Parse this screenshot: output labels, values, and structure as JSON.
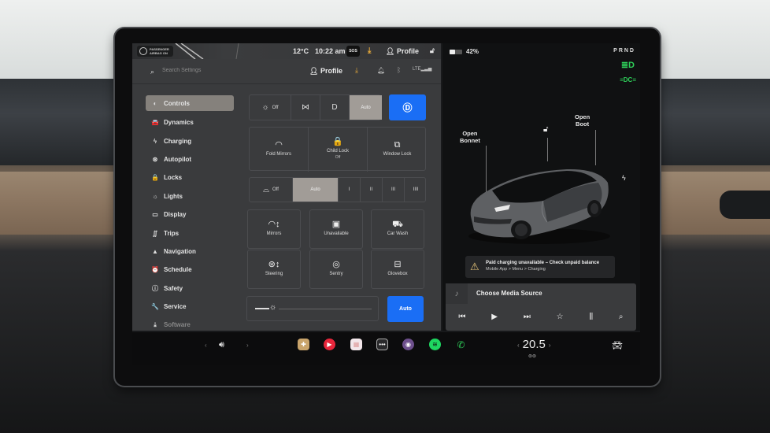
{
  "status_bar": {
    "airbag_label": "PASSENGER AIRBAG ON",
    "temperature": "12°C",
    "time": "10:22 am",
    "sos_label": "SOS",
    "profile": "Profile"
  },
  "settings_header": {
    "search_placeholder": "Search Settings",
    "profile": "Profile"
  },
  "sidebar": {
    "items": [
      {
        "label": "Controls",
        "icon": "toggle-icon",
        "glyph": "◐",
        "active": true
      },
      {
        "label": "Dynamics",
        "icon": "car-icon",
        "glyph": "🚘"
      },
      {
        "label": "Charging",
        "icon": "bolt-icon",
        "glyph": "ϟ"
      },
      {
        "label": "Autopilot",
        "icon": "steering-wheel-icon",
        "glyph": "⊛"
      },
      {
        "label": "Locks",
        "icon": "lock-icon",
        "glyph": "🔒"
      },
      {
        "label": "Lights",
        "icon": "light-icon",
        "glyph": "☼"
      },
      {
        "label": "Display",
        "icon": "display-icon",
        "glyph": "▭"
      },
      {
        "label": "Trips",
        "icon": "trips-icon",
        "glyph": "∬"
      },
      {
        "label": "Navigation",
        "icon": "navigation-icon",
        "glyph": "▲"
      },
      {
        "label": "Schedule",
        "icon": "alarm-icon",
        "glyph": "⏰"
      },
      {
        "label": "Safety",
        "icon": "safety-icon",
        "glyph": "ⓘ"
      },
      {
        "label": "Service",
        "icon": "wrench-icon",
        "glyph": "🔧"
      },
      {
        "label": "Software",
        "icon": "download-icon",
        "glyph": "⤓"
      }
    ]
  },
  "controls": {
    "lights": {
      "options": [
        {
          "label": "Off",
          "icon": "sun-icon",
          "glyph": "☼"
        },
        {
          "label": "",
          "icon": "parking-lights-icon",
          "glyph": "⋈"
        },
        {
          "label": "",
          "icon": "low-beam-icon",
          "glyph": "D"
        },
        {
          "label": "Auto",
          "icon": "",
          "glyph": "",
          "selected": true
        }
      ],
      "auto_high_beam_glyph": "Ⓓ"
    },
    "tiles_row1": [
      {
        "label": "Fold Mirrors",
        "sub": "",
        "icon": "mirror-icon",
        "glyph": "◠"
      },
      {
        "label": "Child Lock",
        "sub": "Off",
        "icon": "child-lock-icon",
        "glyph": "🔒"
      },
      {
        "label": "Window Lock",
        "sub": "",
        "icon": "window-lock-icon",
        "glyph": "⧉"
      }
    ],
    "wipers": {
      "options": [
        {
          "label": "Off",
          "icon": "wiper-icon",
          "glyph": "⌓"
        },
        {
          "label": "Auto",
          "selected": true
        },
        {
          "label": "I"
        },
        {
          "label": "II"
        },
        {
          "label": "III"
        },
        {
          "label": "IIII"
        }
      ]
    },
    "tiles_grid": [
      {
        "label": "Mirrors",
        "icon": "mirror-adjust-icon",
        "glyph": "◠↕"
      },
      {
        "label": "Unavailable",
        "icon": "dashcam-icon",
        "glyph": "▣"
      },
      {
        "label": "Car Wash",
        "icon": "car-wash-icon",
        "glyph": "⛟"
      },
      {
        "label": "Steering",
        "icon": "steering-adjust-icon",
        "glyph": "⊛↕"
      },
      {
        "label": "Sentry",
        "icon": "sentry-icon",
        "glyph": "◎"
      },
      {
        "label": "Glovebox",
        "icon": "glovebox-icon",
        "glyph": "⊟"
      }
    ],
    "brightness": {
      "level_fraction": 0.2,
      "auto_label": "Auto"
    }
  },
  "vehicle": {
    "battery_percent": "42%",
    "battery_fraction": 0.42,
    "gear": "PRND",
    "open_bonnet": [
      "Open",
      "Bonnet"
    ],
    "open_boot": [
      "Open",
      "Boot"
    ],
    "alert_title": "Paid charging unavailable – Check unpaid balance",
    "alert_detail": "Mobile App > Menu > Charging"
  },
  "media": {
    "source_label": "Choose Media Source",
    "controls": [
      "previous",
      "play",
      "next",
      "favorite",
      "equalizer",
      "search"
    ]
  },
  "dock": {
    "cabin_temperature": "20.5",
    "apps": [
      {
        "name": "toybox-app",
        "color": "#c9a46b"
      },
      {
        "name": "youtube-music-app",
        "color": "#e8263b"
      },
      {
        "name": "calendar-app",
        "color": "#f2e6ea"
      },
      {
        "name": "more-apps",
        "color": "#2a2a2c"
      },
      {
        "name": "camera-app",
        "color": "#6d4f8c"
      },
      {
        "name": "spotify-app",
        "color": "#1ed760"
      },
      {
        "name": "phone-app",
        "color": "#0c0c0d"
      }
    ]
  }
}
